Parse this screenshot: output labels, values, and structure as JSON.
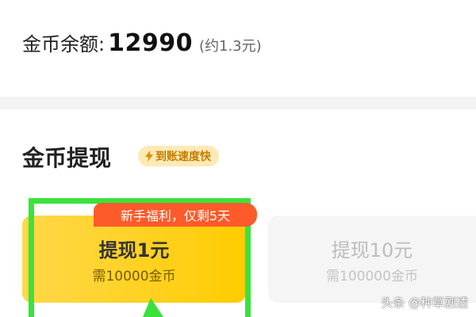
{
  "balance": {
    "label": "金币余额:",
    "value": "12990",
    "approx": "(约1.3元)"
  },
  "withdraw": {
    "title": "金币提现",
    "badge": {
      "icon": "lightning-icon",
      "label": "到账速度快"
    },
    "promo_tag": "新手福利，仅剩5天",
    "options": [
      {
        "title": "提现1元",
        "cost": "需10000金币",
        "selected": true
      },
      {
        "title": "提现10元",
        "cost": "需100000金币",
        "selected": false
      }
    ]
  },
  "colors": {
    "accent_yellow": "#ffcc00",
    "promo_red": "#ff5a2a",
    "highlight_green": "#3be23b",
    "badge_text": "#c47d00"
  },
  "watermark": "头条 @种草剧透"
}
